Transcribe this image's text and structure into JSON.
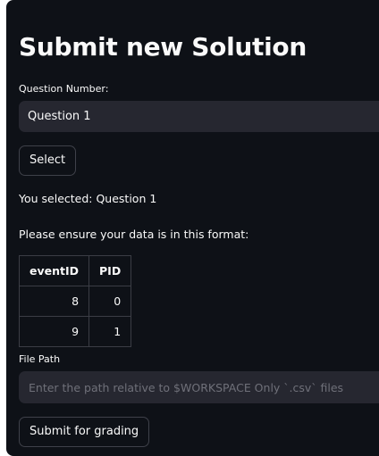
{
  "title": "Submit new Solution",
  "question": {
    "label": "Question Number:",
    "selected": "Question 1"
  },
  "select_button": "Select",
  "selection_text": "You selected: Question 1",
  "format_text": "Please ensure your data is in this format:",
  "format_table": {
    "headers": [
      "eventID",
      "PID"
    ],
    "rows": [
      [
        "8",
        "0"
      ],
      [
        "9",
        "1"
      ]
    ]
  },
  "file_path": {
    "label": "File Path",
    "placeholder": "Enter the path relative to $WORKSPACE Only `.csv` files",
    "value": ""
  },
  "submit_button": "Submit for grading",
  "colors": {
    "background": "#0e1117",
    "input_background": "#262730",
    "text": "#fafafa",
    "placeholder": "#6f7079",
    "border": "#3f414a"
  }
}
